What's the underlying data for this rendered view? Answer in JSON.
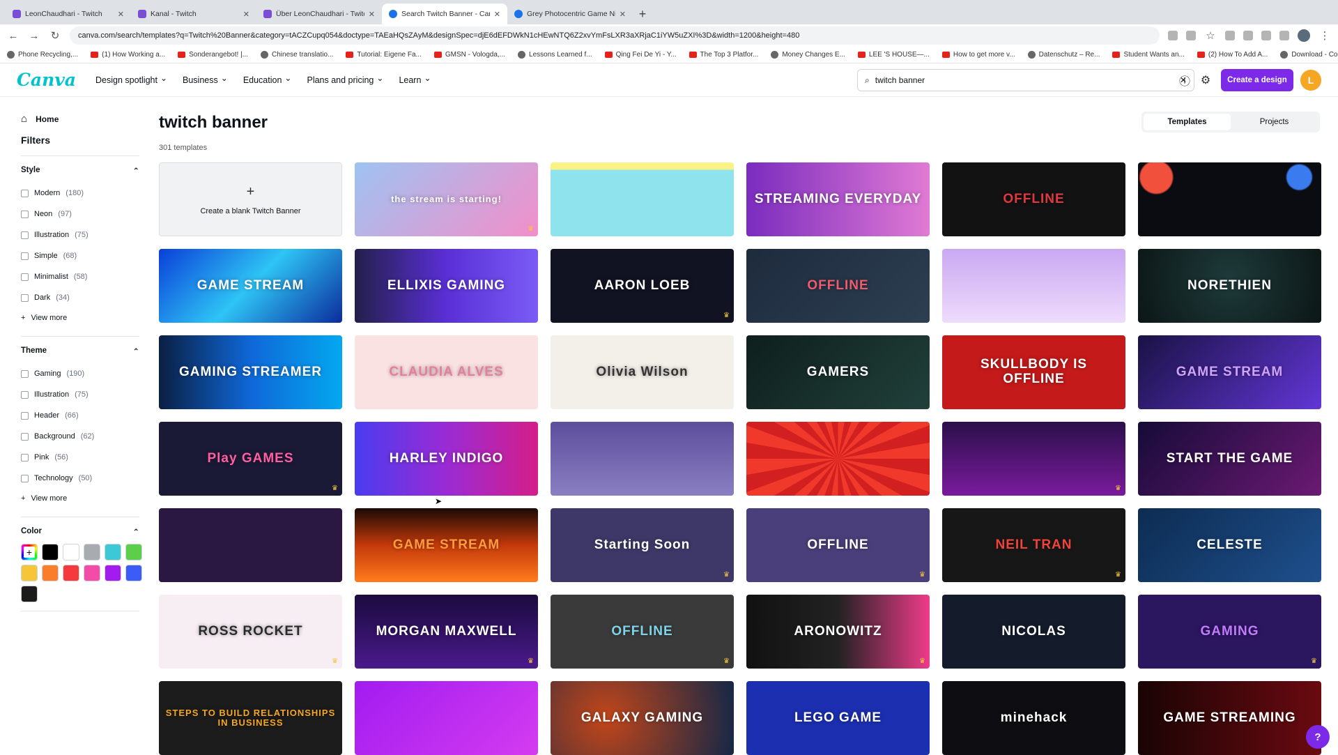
{
  "browser": {
    "tabs": [
      {
        "title": "LeonChaudhari - Twitch",
        "fav": "twitch"
      },
      {
        "title": "Kanal - Twitch",
        "fav": "twitch"
      },
      {
        "title": "Über LeonChaudhari - Twitch",
        "fav": "twitch"
      },
      {
        "title": "Search Twitch Banner - Canva",
        "fav": "canva",
        "active": true
      },
      {
        "title": "Grey Photocentric Game Night",
        "fav": "canva"
      }
    ],
    "url": "canva.com/search/templates?q=Twitch%20Banner&category=tACZCupq054&doctype=TAEaHQsZAyM&designSpec=djE6dEFDWkN1cHEwNTQ6Z2xvYmFsLXR3aXRjaC1iYW5uZXI%3D&width=1200&height=480",
    "bookmarks": [
      "Phone Recycling,...",
      "(1) How Working a...",
      "Sonderangebot! |...",
      "Chinese translatio...",
      "Tutorial: Eigene Fa...",
      "GMSN - Vologda,...",
      "Lessons Learned f...",
      "Qing Fei De Yi - Y...",
      "The Top 3 Platfor...",
      "Money Changes E...",
      "LEE 'S HOUSE—...",
      "How to get more v...",
      "Datenschutz – Re...",
      "Student Wants an...",
      "(2) How To Add A...",
      "Download - Cooki..."
    ]
  },
  "header": {
    "logo": "Canva",
    "nav": [
      "Design spotlight",
      "Business",
      "Education",
      "Plans and pricing",
      "Learn"
    ],
    "search_value": "twitch banner",
    "create_label": "Create a design",
    "avatar_letter": "L"
  },
  "sidebar": {
    "home": "Home",
    "filters": "Filters",
    "sections": [
      {
        "title": "Style",
        "options": [
          {
            "label": "Modern",
            "count": "(180)"
          },
          {
            "label": "Neon",
            "count": "(97)"
          },
          {
            "label": "Illustration",
            "count": "(75)"
          },
          {
            "label": "Simple",
            "count": "(68)"
          },
          {
            "label": "Minimalist",
            "count": "(58)"
          },
          {
            "label": "Dark",
            "count": "(34)"
          }
        ]
      },
      {
        "title": "Theme",
        "options": [
          {
            "label": "Gaming",
            "count": "(190)"
          },
          {
            "label": "Illustration",
            "count": "(75)"
          },
          {
            "label": "Header",
            "count": "(66)"
          },
          {
            "label": "Background",
            "count": "(62)"
          },
          {
            "label": "Pink",
            "count": "(56)"
          },
          {
            "label": "Technology",
            "count": "(50)"
          }
        ]
      }
    ],
    "view_more": "View more",
    "color_title": "Color",
    "colors": [
      "rainbow",
      "#000000",
      "#ffffff",
      "#a8abb0",
      "#3cc8d4",
      "#5ccf4a",
      "#f7c638",
      "#fa7d2c",
      "#f5393d",
      "#f24ca8",
      "#a21cf0",
      "#3b5cf6",
      "#1b1b1b"
    ]
  },
  "main": {
    "title": "twitch banner",
    "count": "301 templates",
    "tabs": [
      "Templates",
      "Projects"
    ],
    "blank_label": "Create a blank Twitch Banner",
    "cards": [
      {
        "text": "the stream is starting!",
        "bg": "linear-gradient(135deg,#9ec3f2,#f38ec9)",
        "crown": true
      },
      {
        "text": "",
        "bg": "linear-gradient(180deg,#fbf286 0 10%,#8fe3ec 10%)",
        "crown": false
      },
      {
        "text": "STREAMING EVERYDAY",
        "bg": "linear-gradient(90deg,#7b2cbf,#e07ad4)",
        "crown": false
      },
      {
        "text": "OFFLINE",
        "bg": "#121212",
        "crown": false,
        "color": "#e0383e"
      },
      {
        "text": "",
        "bg": "radial-gradient(circle at 10% 20%,#f0503c 0 9%,transparent 10%),radial-gradient(circle at 88% 20%,#3b7bf0 0 7%,transparent 8%),#0b0b12",
        "crown": false
      },
      {
        "text": "GAME STREAM",
        "bg": "linear-gradient(135deg,#0a3fd8,#2ec4f5,#0b2c9c)",
        "crown": false
      },
      {
        "text": "ELLIXIS GAMING",
        "bg": "linear-gradient(90deg,#23204a,#5a2fd6,#7a5cf5)",
        "crown": false
      },
      {
        "text": "AARON LOEB",
        "bg": "#111322",
        "crown": true
      },
      {
        "text": "OFFLINE",
        "bg": "linear-gradient(135deg,#1d2b3d,#2e3f52)",
        "crown": false,
        "color": "#ef5b6c"
      },
      {
        "text": "",
        "bg": "linear-gradient(180deg,#c9a8f2,#eedcfb)",
        "crown": false
      },
      {
        "text": "NORETHIEN",
        "bg": "radial-gradient(circle at 50% 40%,#1e3a3a,#0c1616)",
        "crown": false
      },
      {
        "text": "GAMING STREAMER",
        "bg": "linear-gradient(90deg,#0a1f44,#0f68d8,#04a8f0)",
        "crown": false
      },
      {
        "text": "CLAUDIA ALVES",
        "bg": "#fbe2e2",
        "crown": false,
        "color": "#e47fa0"
      },
      {
        "text": "Olivia Wilson",
        "bg": "#f3efe9",
        "crown": false,
        "color": "#333333"
      },
      {
        "text": "GAMERS",
        "bg": "linear-gradient(135deg,#0e1f1c,#21403b)",
        "crown": false
      },
      {
        "text": "SKULLBODY IS OFFLINE",
        "bg": "#c41a1a",
        "crown": false
      },
      {
        "text": "GAME STREAM",
        "bg": "linear-gradient(135deg,#1a1245,#6236d6)",
        "crown": false,
        "color": "#cfa4ff"
      },
      {
        "text": "Play GAMES",
        "bg": "#1b1a36",
        "crown": true,
        "color": "#ff5fa2"
      },
      {
        "text": "HARLEY INDIGO",
        "bg": "linear-gradient(90deg,#4a3cf0,#9a2bd4,#d41e8a)",
        "crown": false
      },
      {
        "text": "",
        "bg": "linear-gradient(180deg,#5d4e9c,#8a7fc2)",
        "crown": false
      },
      {
        "text": "",
        "bg": "repeating-conic-gradient(#f0392b 0 10deg,#d21f1f 10deg 20deg)",
        "crown": false
      },
      {
        "text": "",
        "bg": "linear-gradient(180deg,#2b0f4a,#7a1a9c)",
        "crown": true
      },
      {
        "text": "START THE GAME",
        "bg": "linear-gradient(135deg,#160b38,#6b1a73)",
        "crown": false
      },
      {
        "text": "",
        "bg": "#2a1842",
        "crown": false
      },
      {
        "text": "GAME STREAM",
        "bg": "linear-gradient(180deg,#1a0a05,#c43a0b,#ff7b1c)",
        "crown": false,
        "color": "#ff9a3d"
      },
      {
        "text": "Starting Soon",
        "bg": "#3e3868",
        "crown": true
      },
      {
        "text": "OFFLINE",
        "bg": "#4a3f7a",
        "crown": true
      },
      {
        "text": "NEIL TRAN",
        "bg": "#171717",
        "crown": true,
        "color": "#f0433a"
      },
      {
        "text": "CELESTE",
        "bg": "linear-gradient(135deg,#0d2c52,#1e4f8c)",
        "crown": false
      },
      {
        "text": "ROSS ROCKET",
        "bg": "#f7eef4",
        "crown": true,
        "color": "#2b2b2b"
      },
      {
        "text": "MORGAN MAXWELL",
        "bg": "linear-gradient(180deg,#1a0b3f,#4b1a8c)",
        "crown": true
      },
      {
        "text": "OFFLINE",
        "bg": "#3a3a3a",
        "crown": true,
        "color": "#7fd3e6"
      },
      {
        "text": "ARONOWITZ",
        "bg": "linear-gradient(90deg,#111,#222,#ef3b8a)",
        "crown": true
      },
      {
        "text": "NICOLAS",
        "bg": "#141c2c",
        "crown": false
      },
      {
        "text": "GAMING",
        "bg": "#2b1660",
        "crown": true,
        "color": "#c07bff"
      },
      {
        "text": "STEPS TO BUILD RELATIONSHIPS IN BUSINESS",
        "bg": "#1c1c1c",
        "crown": false,
        "color": "#f5a623"
      },
      {
        "text": "",
        "bg": "linear-gradient(135deg,#a21cf0,#d43cf0)",
        "crown": false
      },
      {
        "text": "GALAXY GAMING",
        "bg": "radial-gradient(circle at 30% 50%,#c2461a,#142746)",
        "crown": false
      },
      {
        "text": "LEGO GAME",
        "bg": "#1b2fb0",
        "crown": false
      },
      {
        "text": "minehack",
        "bg": "#0e0e12",
        "crown": false
      },
      {
        "text": "GAME STREAMING",
        "bg": "linear-gradient(90deg,#1a0404,#6a0a10)",
        "crown": false
      }
    ]
  },
  "help_label": "?"
}
